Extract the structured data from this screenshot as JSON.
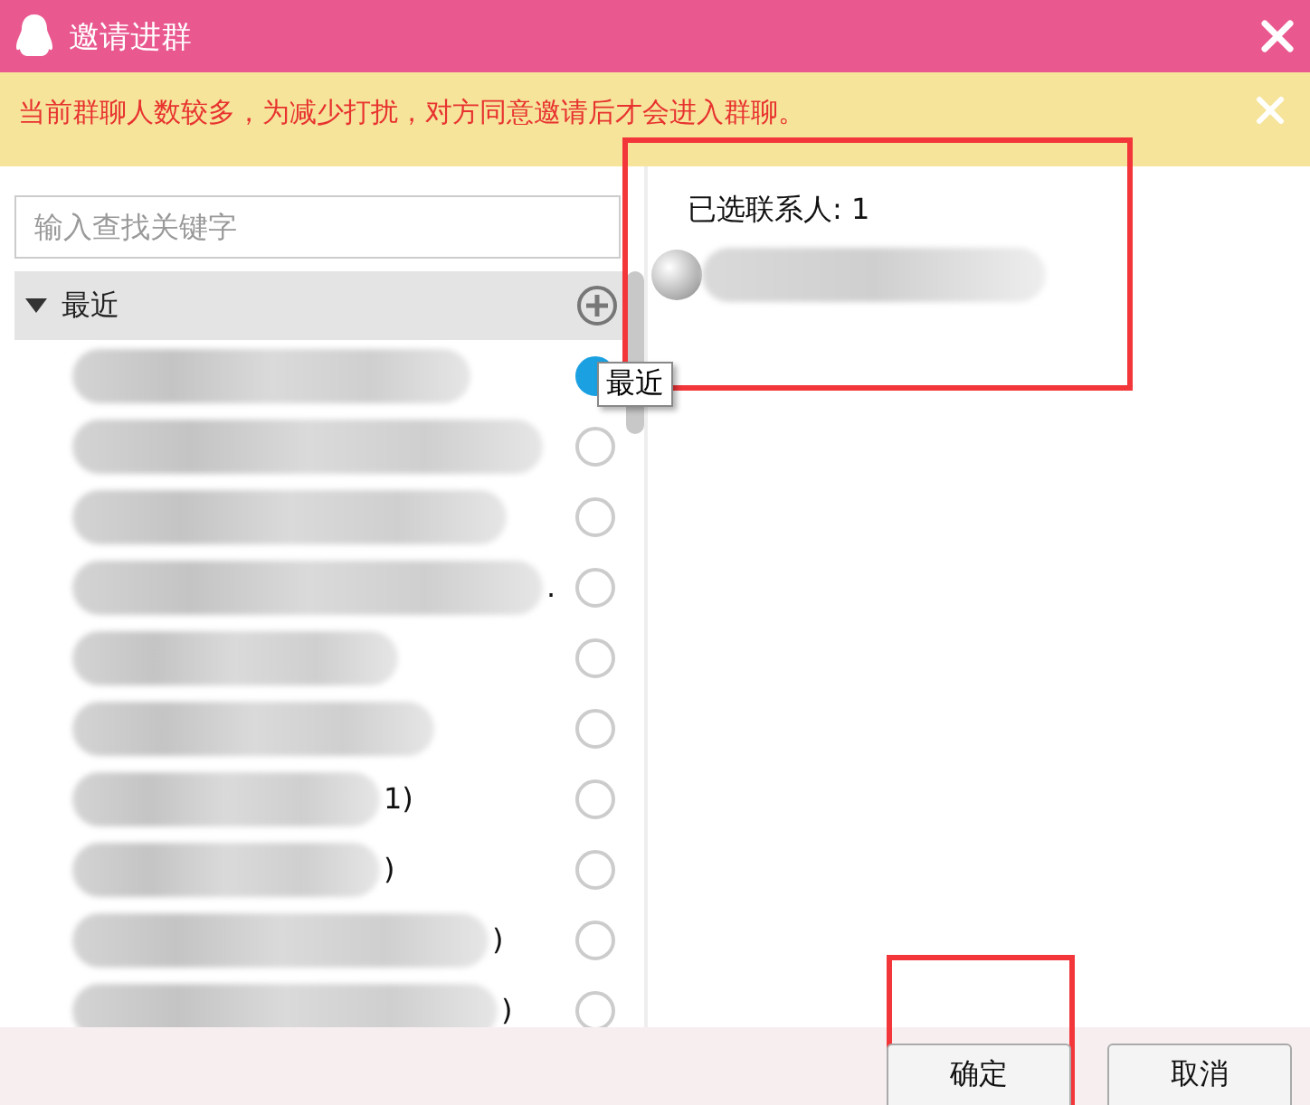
{
  "window": {
    "title": "邀请进群"
  },
  "notice": {
    "text": "当前群聊人数较多，为减少打扰，对方同意邀请后才会进入群聊。"
  },
  "search": {
    "placeholder": "输入查找关键字"
  },
  "group": {
    "label": "最近",
    "expanded": true,
    "tooltip": "最近"
  },
  "contacts": [
    {
      "selected": true
    },
    {
      "selected": false
    },
    {
      "selected": false
    },
    {
      "selected": false,
      "suffix": "."
    },
    {
      "selected": false
    },
    {
      "selected": false
    },
    {
      "selected": false,
      "suffix": "1)"
    },
    {
      "selected": false,
      "suffix": ")"
    },
    {
      "selected": false,
      "suffix": ")"
    },
    {
      "selected": false,
      "suffix": ")"
    }
  ],
  "selected_panel": {
    "heading": "已选联系人: 1"
  },
  "buttons": [
    {
      "label": "确定"
    },
    {
      "label": "取消"
    }
  ]
}
